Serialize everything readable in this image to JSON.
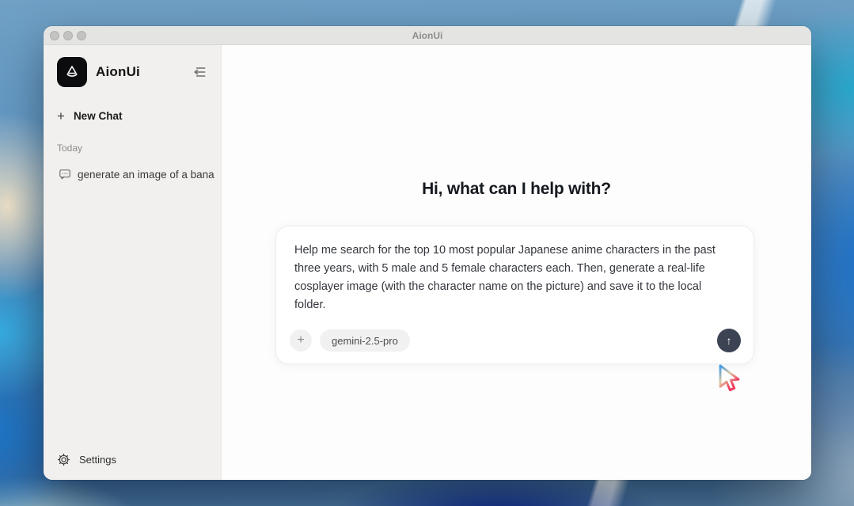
{
  "window": {
    "title": "AionUi"
  },
  "sidebar": {
    "brand": "AionUi",
    "new_chat_label": "New Chat",
    "history_section_label": "Today",
    "chat_items": [
      {
        "label": "generate an image of a bana"
      }
    ],
    "settings_label": "Settings"
  },
  "main": {
    "greeting": "Hi, what can I help with?",
    "composer": {
      "message": "Help me search for the top 10 most popular Japanese anime characters in the past three years, with 5 male and 5 female characters each. Then, generate a real-life cosplayer image (with the character name on the picture) and save it to the local folder.",
      "model_chip": "gemini-2.5-pro"
    }
  },
  "icons": {
    "new_chat_plus": "+",
    "add": "+",
    "send_arrow": "↑"
  },
  "colors": {
    "titlebar_bg": "#e4e4e3",
    "sidebar_bg": "#f1f0ee",
    "chip_bg": "#f1f1f1",
    "send_button_bg": "#3c4353",
    "cursor_gradient_start": "#3b9ae8",
    "cursor_gradient_mid": "#dfc9a4",
    "cursor_gradient_end": "#ef3b5d"
  }
}
